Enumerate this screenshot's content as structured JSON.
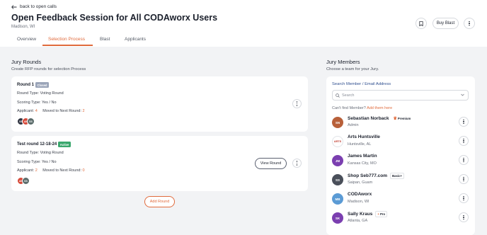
{
  "header": {
    "back_label": "back to open calls",
    "title": "Open Feedback Session for All CODAworx Users",
    "location": "Madison, WI",
    "buy_blast_label": "Buy Blast"
  },
  "tabs": [
    {
      "label": "Overview"
    },
    {
      "label": "Selection Process"
    },
    {
      "label": "Blast"
    },
    {
      "label": "Applicants"
    }
  ],
  "jury_rounds": {
    "title": "Jury Rounds",
    "subtitle": "Create RFP rounds for selection Process",
    "rounds": [
      {
        "name": "Round 1",
        "badge": "Closed",
        "badge_color": "#9aa4b8",
        "round_type": "Round Type: Voting Round",
        "scoring_type": "Scoring Type: Yes / No",
        "applicants_label": "Applicant:",
        "applicants_value": "4",
        "moved_label": "Moved to Next Round:",
        "moved_value": "2",
        "avatars": [
          "SS",
          "AH",
          "SS"
        ]
      },
      {
        "name": "Test round 12-18-24",
        "badge": "Active",
        "badge_color": "#3aa76d",
        "round_type": "Round Type: Voting Round",
        "scoring_type": "Scoring Type: Yes / No",
        "applicants_label": "Applicant:",
        "applicants_value": "2",
        "moved_label": "Moved to Next Round:",
        "moved_value": "0",
        "view_label": "View Round",
        "avatars": [
          "AH",
          "SS"
        ]
      }
    ],
    "add_round_label": "Add Round"
  },
  "jury_members": {
    "title": "Jury Members",
    "subtitle": "Choose a team for your Jury.",
    "search_label": "Search Member / Email Address",
    "search_placeholder": "Search",
    "cant_find": "Can't find Member?",
    "add_them": "Add them here",
    "members": [
      {
        "name": "Sebastian Norback",
        "tag": "Premium",
        "sub": "Admin",
        "initials": "SN",
        "color": "#b8603a"
      },
      {
        "name": "Arts Huntsville",
        "tag": "",
        "sub": "Huntsville, AL",
        "initials": "ARTS",
        "color": "#ffffff"
      },
      {
        "name": "James Martin",
        "tag": "",
        "sub": "Kansas City, MO",
        "initials": "JM",
        "color": "#7b3fb0"
      },
      {
        "name": "Shop Seb777.com",
        "tag": "Basic+",
        "sub": "Saipan, Guam",
        "initials": "SS",
        "color": "#4a4f5a"
      },
      {
        "name": "CODAworx",
        "tag": "",
        "sub": "Madison, WI",
        "initials": "MB",
        "color": "#5b9bd5"
      },
      {
        "name": "Sally Kraus",
        "tag": "Pro",
        "sub": "Atlanta, GA",
        "initials": "SK",
        "color": "#7b3fb0"
      }
    ]
  },
  "colors": {
    "accent": "#e06b3d"
  }
}
